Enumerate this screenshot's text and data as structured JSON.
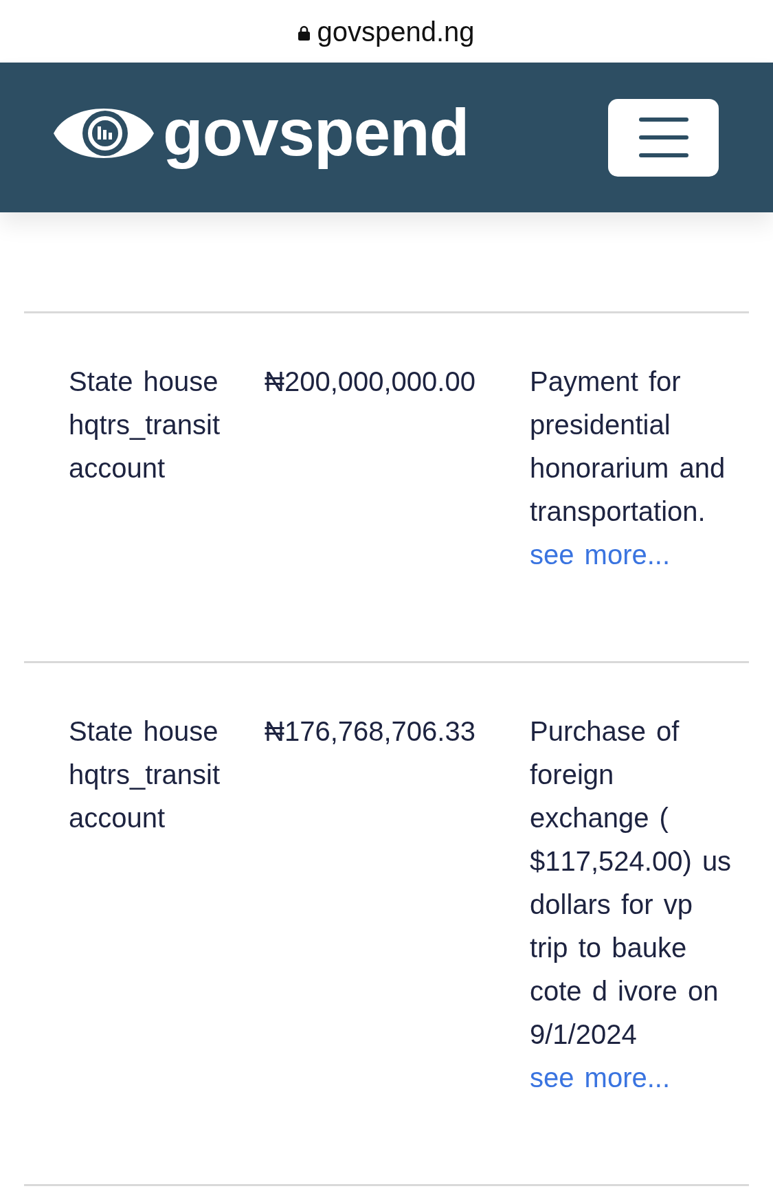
{
  "browser": {
    "secure": true,
    "url": "govspend.ng"
  },
  "navbar": {
    "brand": "govspend"
  },
  "rows": [
    {
      "column_2": "State house hqtrs_transit account",
      "column_3": "₦200,000,000.00",
      "column_4": "Payment for presidential honorarium and transportation.",
      "link": "see more..."
    },
    {
      "column_2": "State house hqtrs_transit account",
      "column_3": "₦176,768,706.33",
      "column_4": "Purchase of foreign exchange ( $117,524.00) us dollars for vp trip to bauke cote d ivore on 9/1/2024",
      "link": "see more..."
    }
  ]
}
